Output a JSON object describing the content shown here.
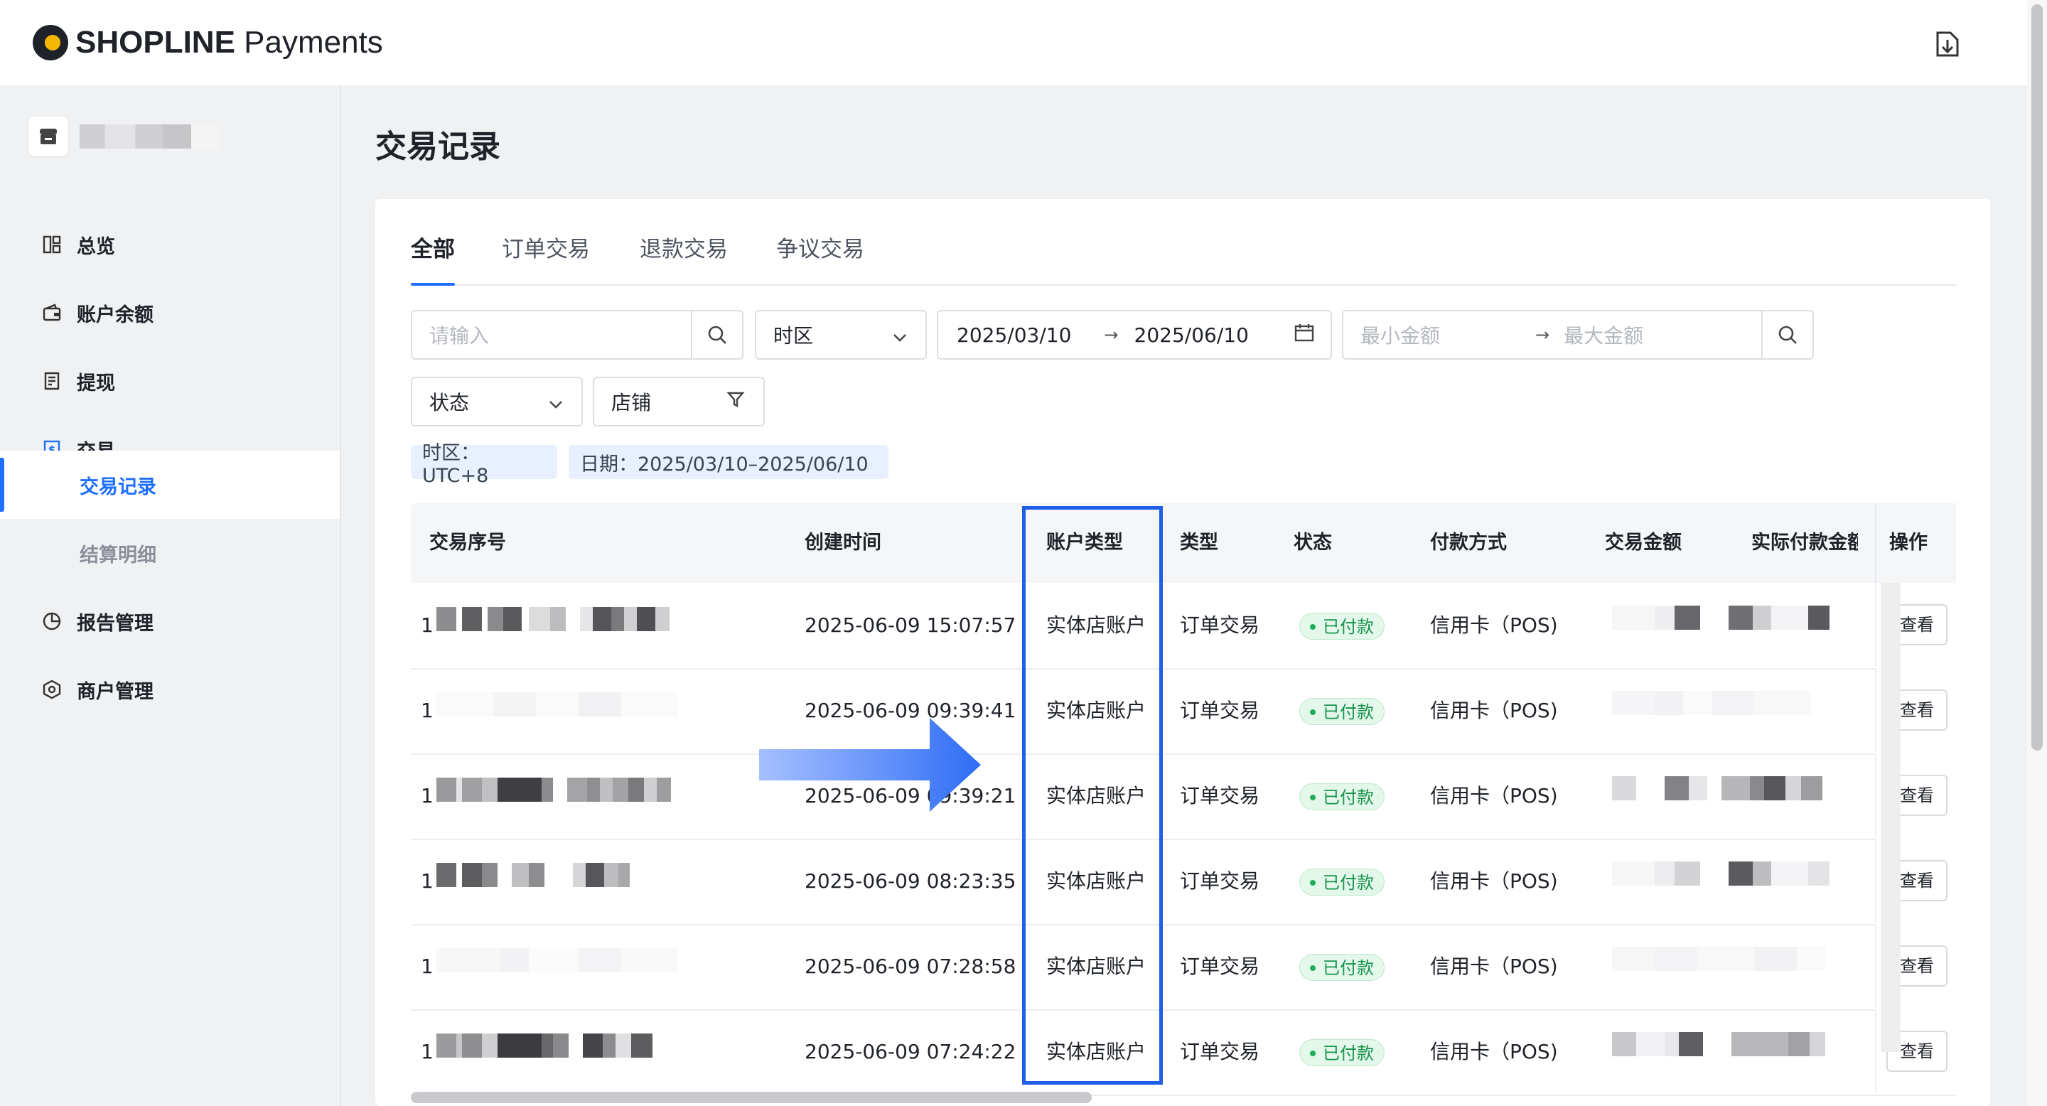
{
  "header": {
    "brand_bold": "SHOPLINE",
    "brand_light": "Payments",
    "download_icon": "download-icon"
  },
  "sidebar": {
    "items": [
      {
        "label": "总览",
        "icon": "dashboard-icon"
      },
      {
        "label": "账户余额",
        "icon": "wallet-icon"
      },
      {
        "label": "提现",
        "icon": "withdraw-icon"
      },
      {
        "label": "交易",
        "icon": "transaction-icon"
      },
      {
        "label": "交易记录",
        "sub": true,
        "active": true
      },
      {
        "label": "结算明细",
        "sub": true
      },
      {
        "label": "报告管理",
        "icon": "report-icon"
      },
      {
        "label": "商户管理",
        "icon": "merchant-icon"
      }
    ]
  },
  "page": {
    "title": "交易记录"
  },
  "tabs": [
    "全部",
    "订单交易",
    "退款交易",
    "争议交易"
  ],
  "filters": {
    "search_placeholder": "请输入",
    "timezone_label": "时区",
    "date_start": "2025/03/10",
    "date_end": "2025/06/10",
    "date_sep": "→",
    "min_amount_placeholder": "最小金额",
    "max_amount_placeholder": "最大金额",
    "status_label": "状态",
    "store_label": "店铺"
  },
  "chips": [
    "时区：UTC+8",
    "日期：2025/03/10–2025/06/10"
  ],
  "table": {
    "columns": [
      "交易序号",
      "创建时间",
      "账户类型",
      "类型",
      "状态",
      "付款方式",
      "交易金额",
      "实际付款金额",
      "操作"
    ],
    "rows": [
      {
        "id_prefix": "1",
        "created": "2025-06-09 15:07:57",
        "account_type": "实体店账户",
        "type": "订单交易",
        "status": "已付款",
        "payment": "信用卡（POS)",
        "action": "查看"
      },
      {
        "id_prefix": "1",
        "created": "2025-06-09 09:39:41",
        "account_type": "实体店账户",
        "type": "订单交易",
        "status": "已付款",
        "payment": "信用卡（POS)",
        "action": "查看"
      },
      {
        "id_prefix": "1",
        "created": "2025-06-09 09:39:21",
        "account_type": "实体店账户",
        "type": "订单交易",
        "status": "已付款",
        "payment": "信用卡（POS)",
        "action": "查看"
      },
      {
        "id_prefix": "1",
        "created": "2025-06-09 08:23:35",
        "account_type": "实体店账户",
        "type": "订单交易",
        "status": "已付款",
        "payment": "信用卡（POS)",
        "action": "查看"
      },
      {
        "id_prefix": "1",
        "created": "2025-06-09 07:28:58",
        "account_type": "实体店账户",
        "type": "订单交易",
        "status": "已付款",
        "payment": "信用卡（POS)",
        "action": "查看"
      },
      {
        "id_prefix": "1",
        "created": "2025-06-09 07:24:22",
        "account_type": "实体店账户",
        "type": "订单交易",
        "status": "已付款",
        "payment": "信用卡（POS)",
        "action": "查看"
      }
    ]
  },
  "colors": {
    "accent": "#1f6fff",
    "highlight_box": "#1f5fe8",
    "status_green": "#17944a"
  }
}
